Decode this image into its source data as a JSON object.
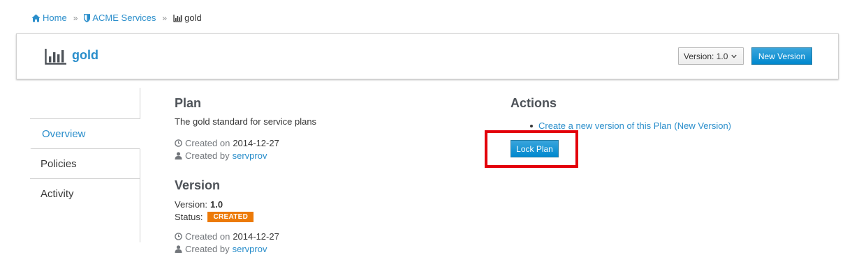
{
  "breadcrumb": {
    "home": "Home",
    "org": "ACME Services",
    "current": "gold",
    "separator": "»"
  },
  "header": {
    "title": "gold",
    "version_select": "Version: 1.0",
    "new_version_button": "New Version"
  },
  "sidebar": {
    "items": [
      {
        "label": "Overview",
        "active": true
      },
      {
        "label": "Policies",
        "active": false
      },
      {
        "label": "Activity",
        "active": false
      }
    ]
  },
  "plan": {
    "heading": "Plan",
    "description": "The gold standard for service plans",
    "created_on_label": "Created on",
    "created_on": "2014-12-27",
    "created_by_label": "Created by",
    "created_by": "servprov"
  },
  "version": {
    "heading": "Version",
    "version_label": "Version:",
    "version_value": "1.0",
    "status_label": "Status:",
    "status_value": "CREATED",
    "created_on_label": "Created on",
    "created_on": "2014-12-27",
    "created_by_label": "Created by",
    "created_by": "servprov"
  },
  "actions": {
    "heading": "Actions",
    "links": [
      "Create a new version of this Plan (New Version)"
    ],
    "lock_button": "Lock Plan"
  },
  "colors": {
    "link": "#2a8ecb",
    "primary_button": "#0088ce",
    "status_badge": "#ec7a08",
    "highlight": "#e3000b"
  }
}
